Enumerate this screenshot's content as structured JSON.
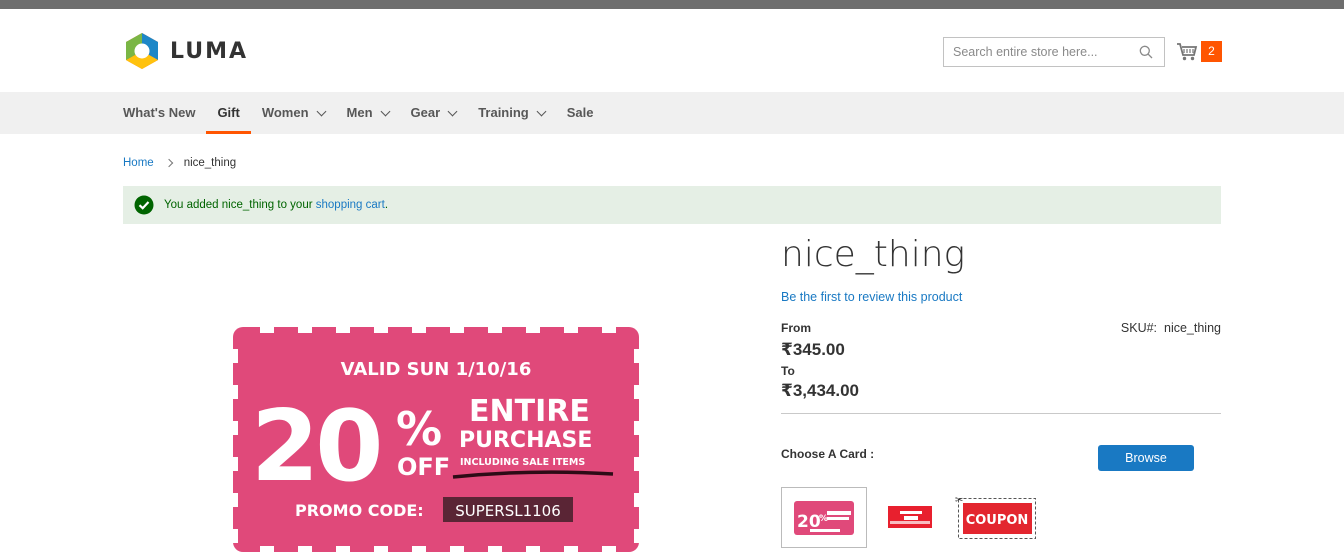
{
  "header": {
    "logo_text": "LUMA",
    "search_placeholder": "Search entire store here...",
    "cart_count": "2"
  },
  "nav": {
    "items": [
      {
        "label": "What's New",
        "dropdown": false,
        "active": false
      },
      {
        "label": "Gift",
        "dropdown": false,
        "active": true
      },
      {
        "label": "Women",
        "dropdown": true,
        "active": false
      },
      {
        "label": "Men",
        "dropdown": true,
        "active": false
      },
      {
        "label": "Gear",
        "dropdown": true,
        "active": false
      },
      {
        "label": "Training",
        "dropdown": true,
        "active": false
      },
      {
        "label": "Sale",
        "dropdown": false,
        "active": false
      }
    ]
  },
  "breadcrumb": {
    "home": "Home",
    "current": "nice_thing"
  },
  "message": {
    "text_before": "You added nice_thing to your ",
    "link": "shopping cart",
    "text_after": "."
  },
  "coupon": {
    "valid": "VALID SUN 1/10/16",
    "percent": "20",
    "percent_sign": "%",
    "off": "OFF",
    "entire": "ENTIRE",
    "purchase": "PURCHASE",
    "including": "INCLUDING SALE ITEMS",
    "promo_label": "PROMO CODE:",
    "promo_code": "SUPERSL1106"
  },
  "product": {
    "title": "nice_thing",
    "review_link": "Be the first to review this product",
    "from_label": "From",
    "from_price": "₹345.00",
    "to_label": "To",
    "to_price": "₹3,434.00",
    "sku_label": "SKU#:",
    "sku_value": "nice_thing",
    "choose_label": "Choose A Card :",
    "browse_label": "Browse",
    "thumb3_text": "COUPON"
  },
  "colors": {
    "accent": "#ff5501",
    "link": "#1979c3",
    "coupon_pink": "#e0497a",
    "success_bg": "#e5efe5"
  }
}
